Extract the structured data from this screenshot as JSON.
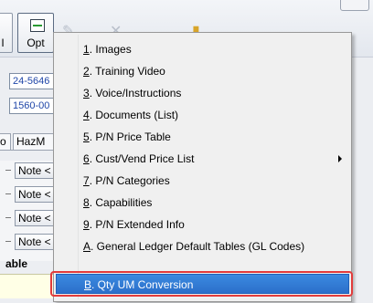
{
  "toolbar": {
    "opt_label": "Opt",
    "left_label": "I"
  },
  "fields": [
    {
      "value": "24-5646"
    },
    {
      "value": "1560-00"
    }
  ],
  "tabs": [
    {
      "label": "o"
    },
    {
      "label": "HazM"
    }
  ],
  "notes": [
    {
      "label": "Note <"
    },
    {
      "label": "Note <"
    },
    {
      "label": "Note <"
    },
    {
      "label": "Note <"
    }
  ],
  "grid_label": "able",
  "menu": {
    "items": [
      {
        "key": "1",
        "rest": ". Images"
      },
      {
        "key": "2",
        "rest": ". Training Video"
      },
      {
        "key": "3",
        "rest": ". Voice/Instructions"
      },
      {
        "key": "4",
        "rest": ". Documents (List)"
      },
      {
        "key": "5",
        "rest": ". P/N Price Table"
      },
      {
        "key": "6",
        "rest": ". Cust/Vend Price List"
      },
      {
        "key": "7",
        "rest": ". P/N Categories"
      },
      {
        "key": "8",
        "rest": ". Capabilities"
      },
      {
        "key": "9",
        "rest": ". P/N Extended Info"
      },
      {
        "key": "A",
        "rest": ". General Ledger Default Tables (GL Codes)"
      },
      {
        "key": "B",
        "rest": ". Qty UM Conversion"
      }
    ]
  },
  "colors": {
    "highlight": "#3b8ae0",
    "outline": "#e23b3b"
  }
}
